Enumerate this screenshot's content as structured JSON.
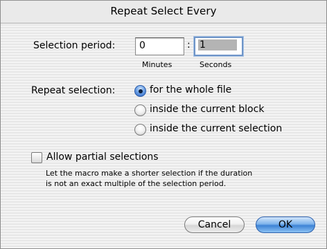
{
  "window": {
    "title": "Repeat Select Every"
  },
  "period": {
    "label": "Selection period:",
    "minutes_value": "0",
    "separator": ":",
    "seconds_value": "1",
    "minutes_caption": "Minutes",
    "seconds_caption": "Seconds"
  },
  "repeat": {
    "label": "Repeat selection:",
    "options": [
      {
        "label": "for the whole file",
        "checked": true
      },
      {
        "label": "inside the current block",
        "checked": false
      },
      {
        "label": "inside the current selection",
        "checked": false
      }
    ]
  },
  "partial": {
    "label": "Allow partial selections",
    "checked": false,
    "help_line1": "Let the macro make a shorter selection if the duration",
    "help_line2": "is not an exact multiple of the selection period."
  },
  "buttons": {
    "cancel": "Cancel",
    "ok": "OK"
  },
  "colors": {
    "accent": "#3d83d6",
    "focus_ring": "#6f95c8"
  }
}
